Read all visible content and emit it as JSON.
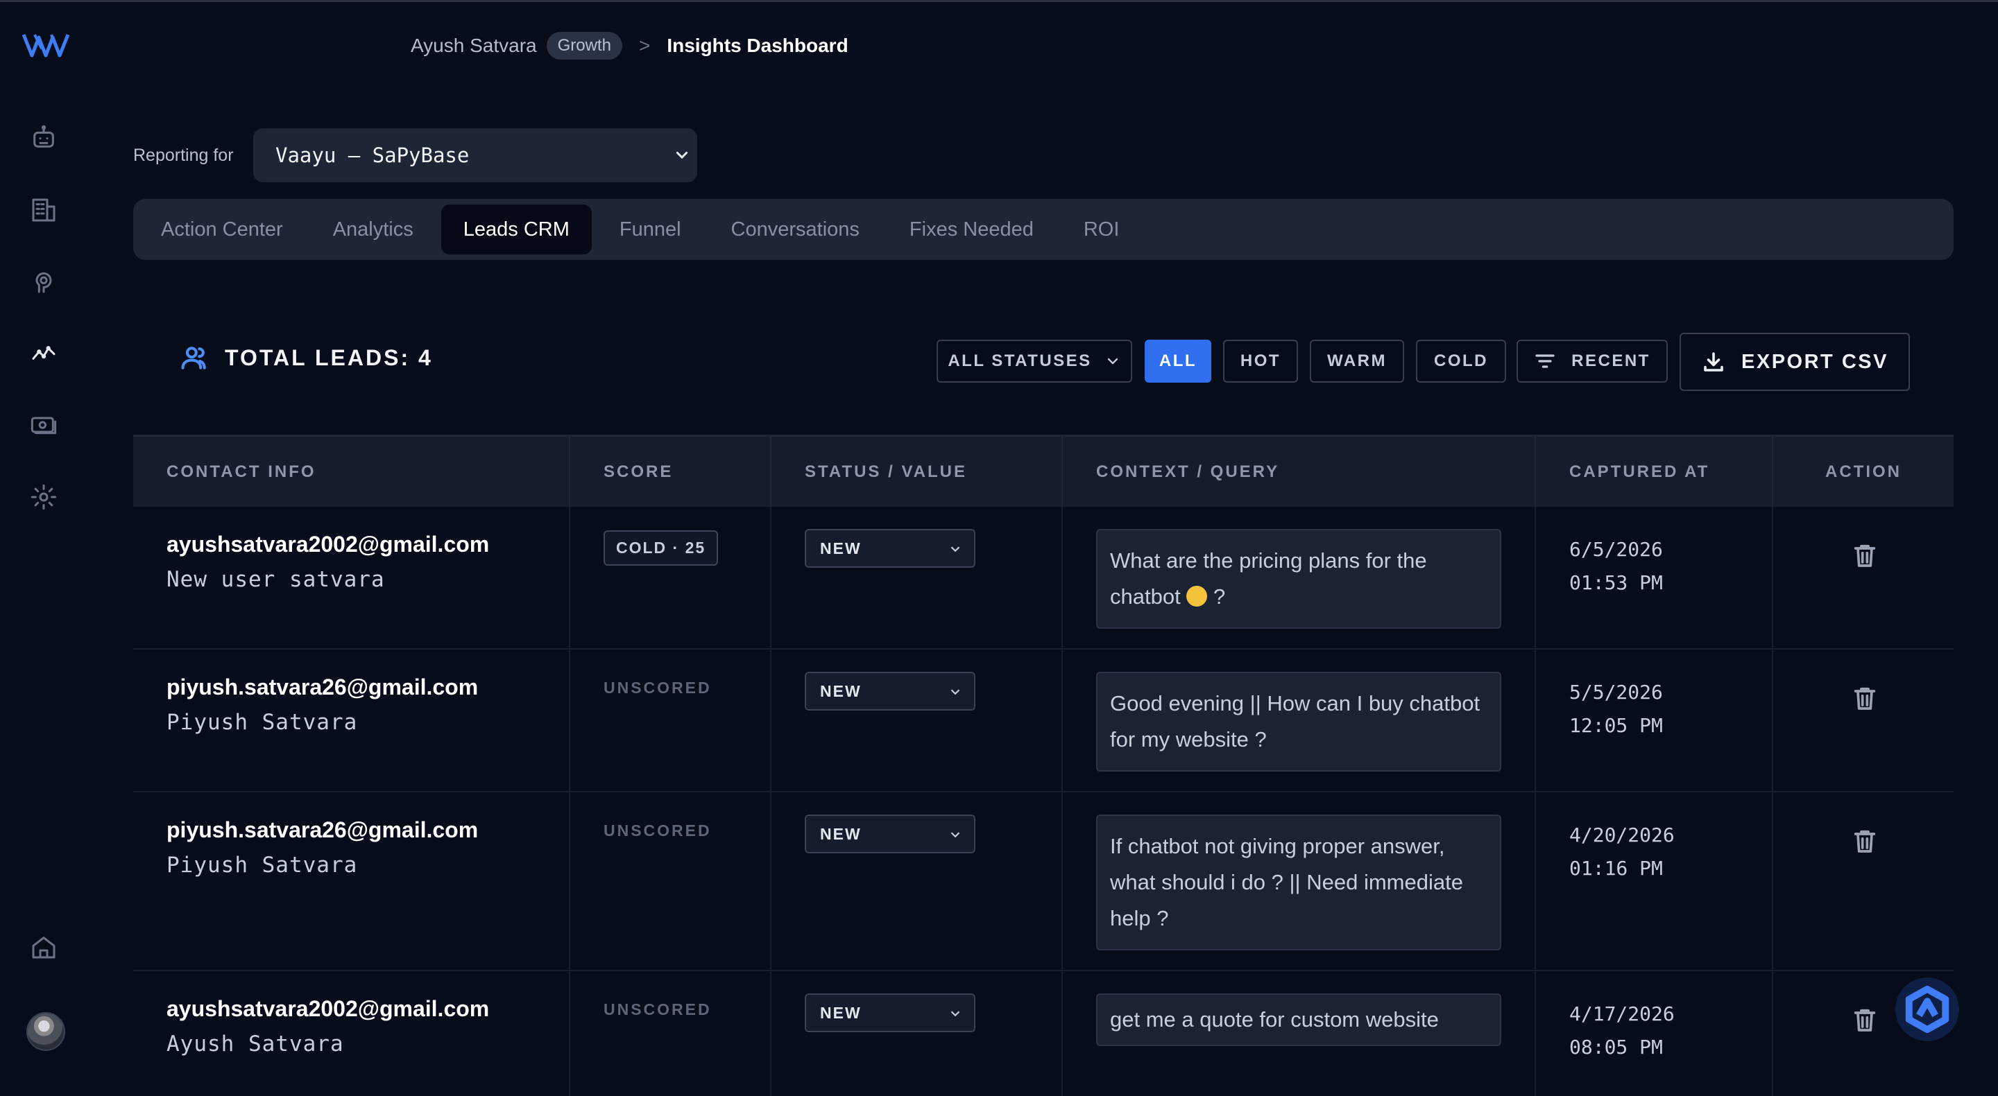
{
  "breadcrumb": {
    "user": "Ayush Satvara",
    "plan_badge": "Growth",
    "separator": ">",
    "page": "Insights Dashboard"
  },
  "sidebar": {
    "items": [
      {
        "icon": "bot-icon"
      },
      {
        "icon": "building-icon"
      },
      {
        "icon": "brain-icon"
      },
      {
        "icon": "analytics-icon",
        "active": true
      },
      {
        "icon": "money-icon"
      },
      {
        "icon": "settings-icon"
      },
      {
        "icon": "home-icon"
      }
    ]
  },
  "reporting": {
    "label": "Reporting for",
    "selected": "Vaayu — SaPyBase"
  },
  "tabs": [
    {
      "label": "Action Center"
    },
    {
      "label": "Analytics"
    },
    {
      "label": "Leads CRM",
      "active": true
    },
    {
      "label": "Funnel"
    },
    {
      "label": "Conversations"
    },
    {
      "label": "Fixes Needed"
    },
    {
      "label": "ROI"
    }
  ],
  "leads": {
    "title": "TOTAL LEADS: 4",
    "status_filter": "ALL STATUSES",
    "temp_filters": [
      "ALL",
      "HOT",
      "WARM",
      "COLD"
    ],
    "active_temp_filter": "ALL",
    "sort_label": "RECENT",
    "export_label": "EXPORT CSV"
  },
  "table": {
    "columns": [
      "CONTACT INFO",
      "SCORE",
      "STATUS / VALUE",
      "CONTEXT / QUERY",
      "CAPTURED AT",
      "ACTION"
    ],
    "rows": [
      {
        "email": "ayushsatvara2002@gmail.com",
        "name": "New user satvara",
        "score": "COLD · 25",
        "status": "NEW",
        "query_a": "What are the pricing plans for the chatbot",
        "query_b": " ?",
        "date": "6/5/2026",
        "time": "01:53 PM"
      },
      {
        "email": "piyush.satvara26@gmail.com",
        "name": "Piyush Satvara",
        "score": "UNSCORED",
        "status": "NEW",
        "query_a": "Good evening || How can I buy chatbot for my website ?",
        "query_b": "",
        "date": "5/5/2026",
        "time": "12:05 PM"
      },
      {
        "email": "piyush.satvara26@gmail.com",
        "name": "Piyush Satvara",
        "score": "UNSCORED",
        "status": "NEW",
        "query_a": "If chatbot not giving proper answer, what should i do ? || Need immediate help ?",
        "query_b": "",
        "date": "4/20/2026",
        "time": "01:16 PM"
      },
      {
        "email": "ayushsatvara2002@gmail.com",
        "name": "Ayush Satvara",
        "score": "UNSCORED",
        "status": "NEW",
        "query_a": "get me a quote for custom website",
        "query_b": "",
        "date": "4/17/2026",
        "time": "08:05 PM"
      }
    ]
  },
  "colors": {
    "background": "#070c1b",
    "accent": "#2f6ff0",
    "panel": "#1e2636"
  }
}
